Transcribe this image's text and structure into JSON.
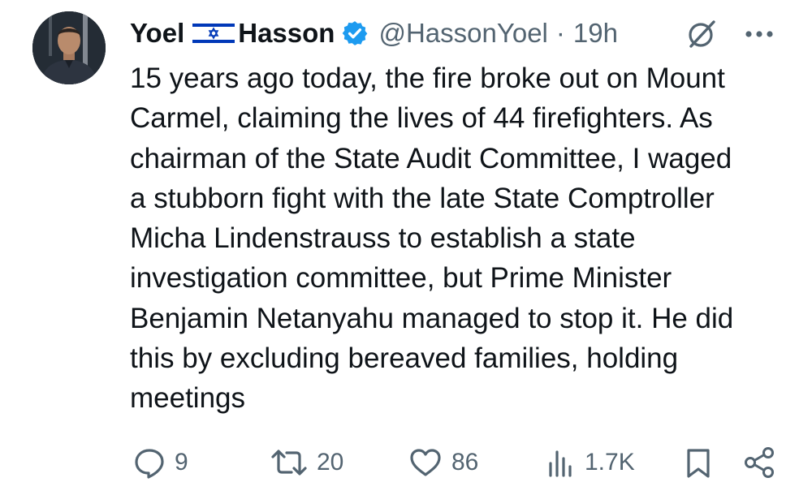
{
  "post": {
    "author": {
      "name_first": "Yoel",
      "name_last": "Hasson",
      "handle": "@HassonYoel",
      "separator": "·",
      "time": "19h"
    },
    "text": "15 years ago today, the fire broke out on Mount\nCarmel, claiming the lives of 44 firefighters. As\nchairman of the State Audit Committee, I waged\na stubborn fight with the late State Comptroller\nMicha Lindenstrauss to establish a state\ninvestigation committee, but Prime Minister\nBenjamin Netanyahu managed to stop it. He did\nthis by excluding bereaved families, holding\nmeetings",
    "actions": {
      "replies": "9",
      "reposts": "20",
      "likes": "86",
      "views": "1.7K"
    }
  },
  "icons": [
    "israel-flag-icon",
    "verified-badge-icon",
    "grok-icon",
    "more-icon",
    "reply-icon",
    "repost-icon",
    "like-icon",
    "views-icon",
    "bookmark-icon",
    "share-icon"
  ],
  "colors": {
    "text": "#0f1419",
    "secondary": "#536471",
    "verified": "#1d9bf0",
    "flag_blue": "#0038b8"
  }
}
